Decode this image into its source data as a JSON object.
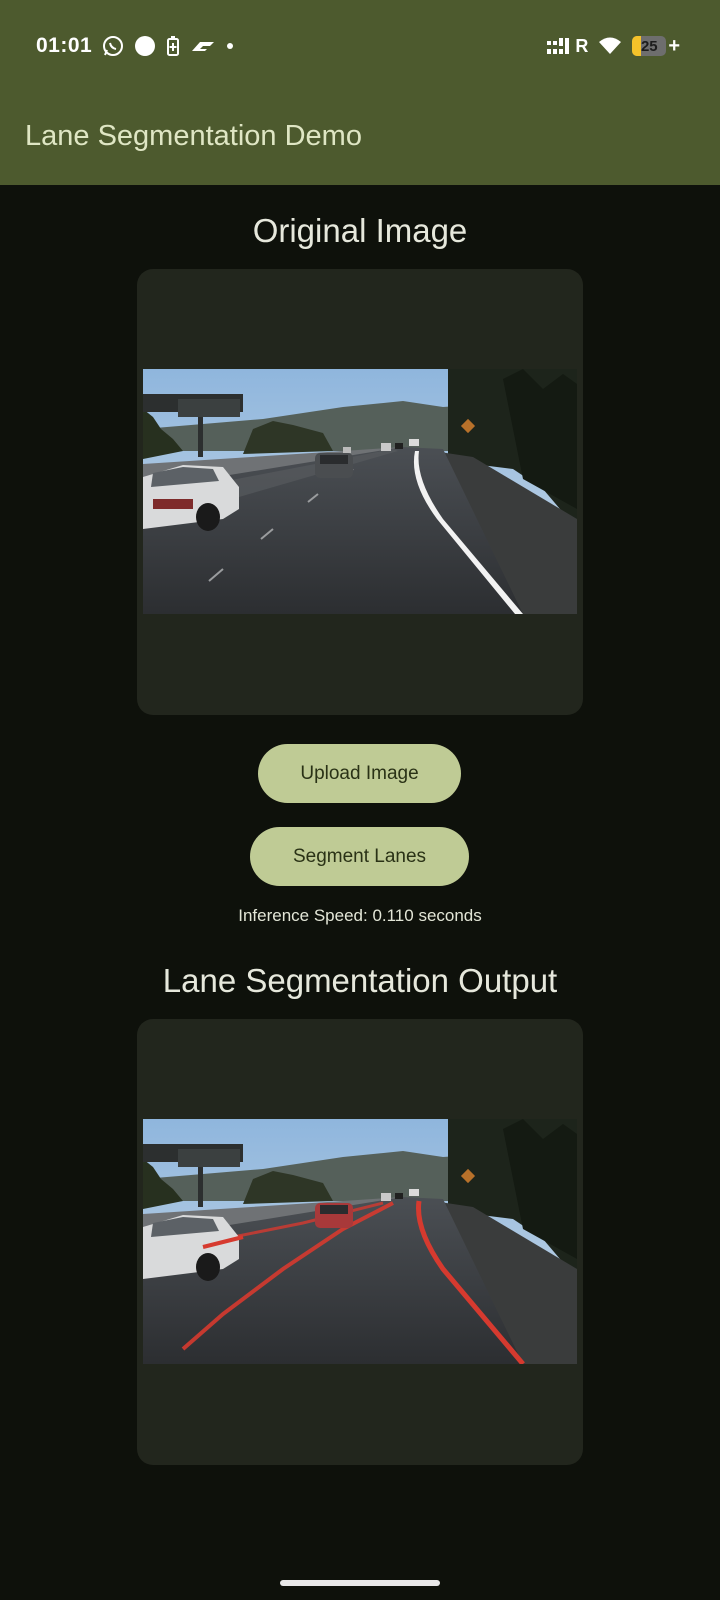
{
  "status_bar": {
    "time": "01:01",
    "battery_level": "25",
    "battery_plus": "+",
    "signal_label": "R",
    "icons_left": [
      "whatsapp-icon",
      "circle-icon",
      "battery-saver-icon",
      "f1-icon",
      "dot-icon"
    ],
    "icons_right": [
      "signal-icon",
      "wifi-icon",
      "battery-icon"
    ]
  },
  "app_bar": {
    "title": "Lane Segmentation Demo",
    "background": "#4d5a2e"
  },
  "original": {
    "heading": "Original Image"
  },
  "buttons": {
    "upload_label": "Upload Image",
    "segment_label": "Segment Lanes",
    "color": "#bfcb95"
  },
  "inference": {
    "text": "Inference Speed: 0.110 seconds"
  },
  "output": {
    "heading": "Lane Segmentation Output",
    "lane_color": "#d63a2f"
  }
}
